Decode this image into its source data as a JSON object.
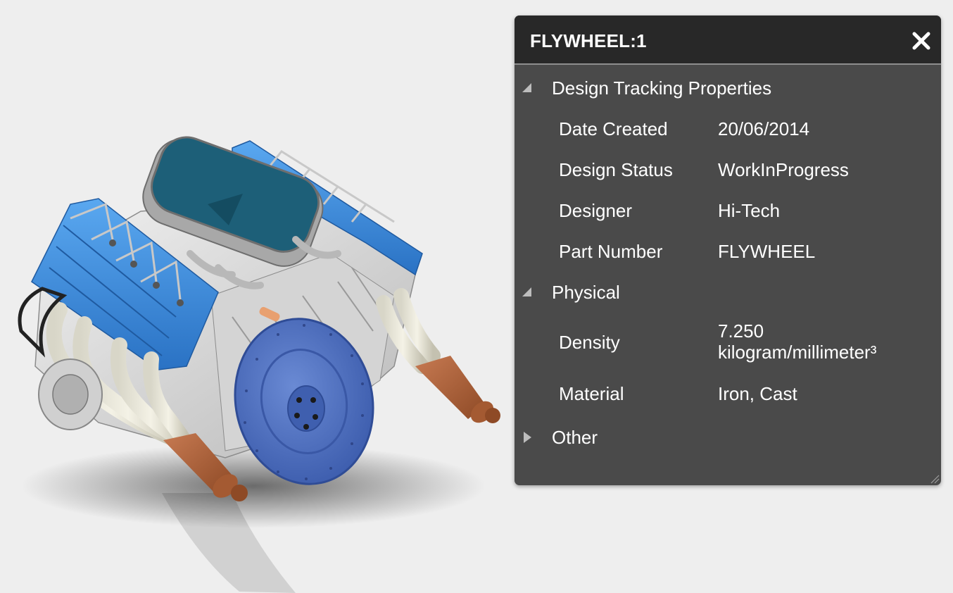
{
  "panel": {
    "title": "FLYWHEEL:1",
    "close_icon": "close-icon",
    "sections": [
      {
        "label": "Design Tracking Properties",
        "expanded": true,
        "properties": [
          {
            "key": "Date Created",
            "value": "20/06/2014"
          },
          {
            "key": "Design Status",
            "value": "WorkInProgress"
          },
          {
            "key": "Designer",
            "value": "Hi-Tech"
          },
          {
            "key": "Part Number",
            "value": "FLYWHEEL"
          }
        ]
      },
      {
        "label": "Physical",
        "expanded": true,
        "properties": [
          {
            "key": "Density",
            "value_line1": "7.250",
            "value_line2": "kilogram/millimeter³"
          },
          {
            "key": "Material",
            "value": "Iron, Cast"
          }
        ]
      },
      {
        "label": "Other",
        "expanded": false
      }
    ]
  },
  "colors": {
    "panel_bg": "#4a4a4a",
    "header_bg": "#282828",
    "canvas_bg": "#eeeeee",
    "valve_cover_blue": "#3d8fe0",
    "flywheel_blue": "#4f74c4",
    "exhaust_copper": "#b5653d",
    "intake_teal": "#1d5f78"
  }
}
